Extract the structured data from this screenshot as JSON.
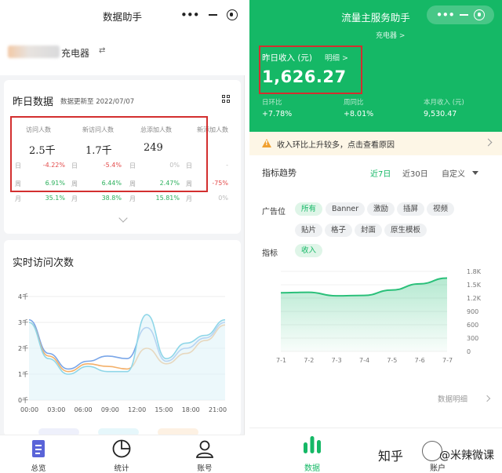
{
  "left_app": {
    "title": "数据助手",
    "store_name": "充电器",
    "yesterday": {
      "title": "昨日数据",
      "update_note": "数据更新至 2022/07/07",
      "columns": [
        {
          "label": "访问人数",
          "value": "2.5千",
          "rows": [
            {
              "k": "日",
              "v": "-4.22%",
              "tone": "red"
            },
            {
              "k": "周",
              "v": "6.91%",
              "tone": "green"
            },
            {
              "k": "月",
              "v": "35.1%",
              "tone": "green"
            }
          ]
        },
        {
          "label": "新访问人数",
          "value": "1.7千",
          "rows": [
            {
              "k": "日",
              "v": "-5.4%",
              "tone": "red"
            },
            {
              "k": "周",
              "v": "6.44%",
              "tone": "green"
            },
            {
              "k": "月",
              "v": "38.8%",
              "tone": "green"
            }
          ]
        },
        {
          "label": "总添加人数",
          "value": "249",
          "rows": [
            {
              "k": "日",
              "v": "0%",
              "tone": "grey"
            },
            {
              "k": "周",
              "v": "2.47%",
              "tone": "green"
            },
            {
              "k": "月",
              "v": "15.81%",
              "tone": "green"
            }
          ]
        },
        {
          "label": "新添加人数",
          "value": "",
          "rows": [
            {
              "k": "日",
              "v": "-",
              "tone": "grey"
            },
            {
              "k": "周",
              "v": "-75%",
              "tone": "red"
            },
            {
              "k": "月",
              "v": "0%",
              "tone": "grey"
            }
          ]
        }
      ]
    },
    "realtime": {
      "title": "实时访问次数",
      "y_ticks": [
        "4千",
        "3千",
        "2千",
        "1千",
        "0千"
      ],
      "x_ticks": [
        "00:00",
        "03:00",
        "06:00",
        "09:00",
        "12:00",
        "15:00",
        "18:00",
        "21:00"
      ]
    },
    "tabs": [
      {
        "label": "总览",
        "icon": "document-icon",
        "active": true
      },
      {
        "label": "统计",
        "icon": "pie-chart-icon",
        "active": false
      },
      {
        "label": "账号",
        "icon": "user-icon",
        "active": false
      }
    ]
  },
  "right_app": {
    "title": "流量主服务助手",
    "store_name": "充电器 >",
    "income_label": "昨日收入 (元)",
    "income_detail": "明细 >",
    "income_value": "1,626.27",
    "sub_stats": [
      {
        "label": "日环比",
        "value": "+7.78%"
      },
      {
        "label": "周同比",
        "value": "+8.01%"
      },
      {
        "label": "本月收入 (元)",
        "value": "9,530.47"
      }
    ],
    "notice": "收入环比上升较多，点击查看原因",
    "trend": {
      "title": "指标趋势",
      "periods": [
        "近7日",
        "近30日",
        "自定义"
      ],
      "active_period": "近7日"
    },
    "ad_slot_label": "广告位",
    "ad_slots_row1": [
      "所有",
      "Banner",
      "激励",
      "插屏",
      "视频"
    ],
    "ad_slots_row2": [
      "贴片",
      "格子",
      "封面",
      "原生模板"
    ],
    "metric_label": "指标",
    "metrics": [
      "收入"
    ],
    "detail_link": "数据明细",
    "tabs": [
      {
        "label": "数据",
        "icon": "bar-chart-icon",
        "active": true
      },
      {
        "label": "账户",
        "icon": "account-icon",
        "active": false
      }
    ],
    "watermark": "知乎",
    "watermark_author": "@米辣微课"
  },
  "chart_data": [
    {
      "type": "line",
      "title": "实时访问次数",
      "x": [
        "00:00",
        "03:00",
        "06:00",
        "09:00",
        "12:00",
        "15:00",
        "18:00",
        "21:00"
      ],
      "ylim": [
        0,
        4000
      ],
      "y_ticks_text": [
        "0千",
        "1千",
        "2千",
        "3千",
        "4千"
      ],
      "series": [
        {
          "values": [
            3100,
            1800,
            1200,
            1500,
            1700,
            1600,
            2800,
            1500,
            2000,
            2400,
            3000
          ],
          "color": "#7aa6e8"
        },
        {
          "values": [
            3000,
            1700,
            1100,
            1400,
            1300,
            1200,
            2000,
            1400,
            1800,
            2300,
            2900
          ],
          "color": "#f3b06a"
        },
        {
          "values": [
            3000,
            1600,
            1000,
            1300,
            1100,
            1100,
            3300,
            1600,
            2200,
            2500,
            3100
          ],
          "color": "#8fd6e8"
        }
      ]
    },
    {
      "type": "area",
      "x": [
        "7-1",
        "7-2",
        "7-3",
        "7-4",
        "7-5",
        "7-6",
        "7-7"
      ],
      "values": [
        1320,
        1330,
        1250,
        1260,
        1380,
        1520,
        1650
      ],
      "ylim": [
        0,
        1800
      ],
      "y_ticks": [
        0,
        300,
        600,
        900,
        "1.2K",
        "1.5K",
        "1.8K"
      ],
      "color": "#2bc07a"
    }
  ]
}
